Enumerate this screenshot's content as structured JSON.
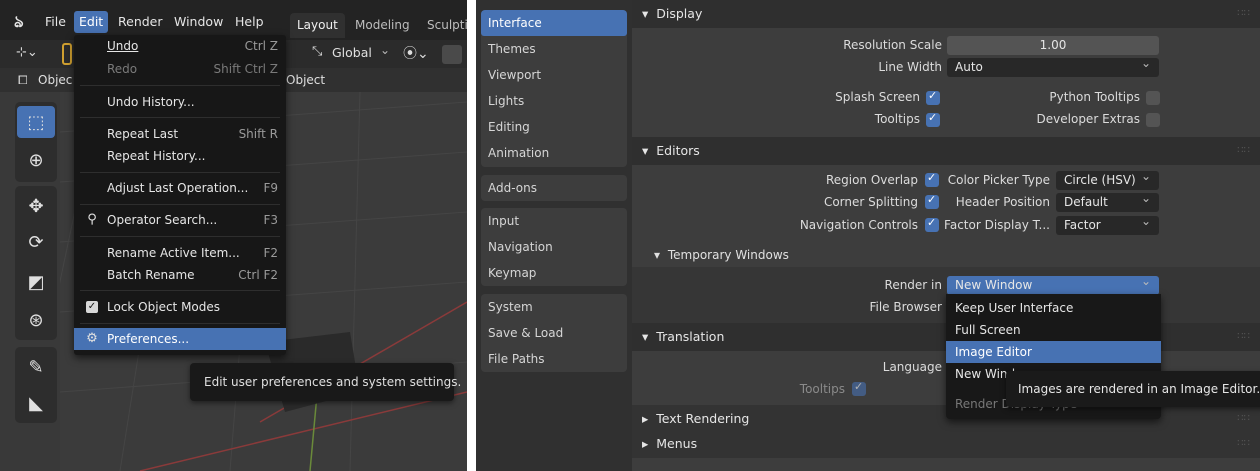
{
  "left": {
    "menubar": {
      "items": [
        "File",
        "Edit",
        "Render",
        "Window",
        "Help"
      ],
      "active": "Edit"
    },
    "workspace_tabs": [
      "Layout",
      "Modeling",
      "Sculpti"
    ],
    "header": {
      "transform_orientation": "Global",
      "mode_left": "Objec",
      "mode_right": "Object"
    },
    "edit_menu": {
      "undo": "Undo",
      "undo_sc": "Ctrl Z",
      "redo": "Redo",
      "redo_sc": "Shift Ctrl Z",
      "undo_history": "Undo History...",
      "repeat_last": "Repeat Last",
      "repeat_last_sc": "Shift R",
      "repeat_history": "Repeat History...",
      "adjust_last": "Adjust Last Operation...",
      "adjust_last_sc": "F9",
      "operator_search": "Operator Search...",
      "operator_search_sc": "F3",
      "rename_active": "Rename Active Item...",
      "rename_active_sc": "F2",
      "batch_rename": "Batch Rename",
      "batch_rename_sc": "Ctrl F2",
      "lock_modes": "Lock Object Modes",
      "preferences": "Preferences..."
    },
    "tooltip": "Edit user preferences and system settings."
  },
  "right": {
    "nav": {
      "group1": [
        "Interface",
        "Themes",
        "Viewport",
        "Lights",
        "Editing",
        "Animation"
      ],
      "group2": [
        "Add-ons"
      ],
      "group3": [
        "Input",
        "Navigation",
        "Keymap"
      ],
      "group4": [
        "System",
        "Save & Load",
        "File Paths"
      ],
      "active": "Interface"
    },
    "display": {
      "header": "Display",
      "resolution_scale_label": "Resolution Scale",
      "resolution_scale_value": "1.00",
      "line_width_label": "Line Width",
      "line_width_value": "Auto",
      "splash_label": "Splash Screen",
      "splash_on": true,
      "python_tooltips_label": "Python Tooltips",
      "python_tooltips_on": false,
      "tooltips_label": "Tooltips",
      "tooltips_on": true,
      "dev_extras_label": "Developer Extras",
      "dev_extras_on": false
    },
    "editors": {
      "header": "Editors",
      "region_overlap_label": "Region Overlap",
      "corner_splitting_label": "Corner Splitting",
      "nav_controls_label": "Navigation Controls",
      "color_picker_label": "Color Picker Type",
      "color_picker_value": "Circle (HSV)",
      "header_position_label": "Header Position",
      "header_position_value": "Default",
      "factor_display_label": "Factor Display T...",
      "factor_display_value": "Factor",
      "temp_windows_header": "Temporary Windows",
      "render_in_label": "Render in",
      "render_in_value": "New Window",
      "file_browser_label": "File Browser"
    },
    "render_dropdown": {
      "keep_ui": "Keep User Interface",
      "full_screen": "Full Screen",
      "image_editor": "Image Editor",
      "new_window": "New Wind",
      "render_display_type": "Render Display Type"
    },
    "translation": {
      "header": "Translation",
      "language_label": "Language",
      "tooltips_label": "Tooltips"
    },
    "tooltip": "Images are rendered in an Image Editor.",
    "text_rendering": "Text Rendering",
    "menus": "Menus",
    "colors": {
      "accent": "#4772b3",
      "panel_bg": "#3d3d3d",
      "header_bg": "#2f2f2f"
    }
  }
}
